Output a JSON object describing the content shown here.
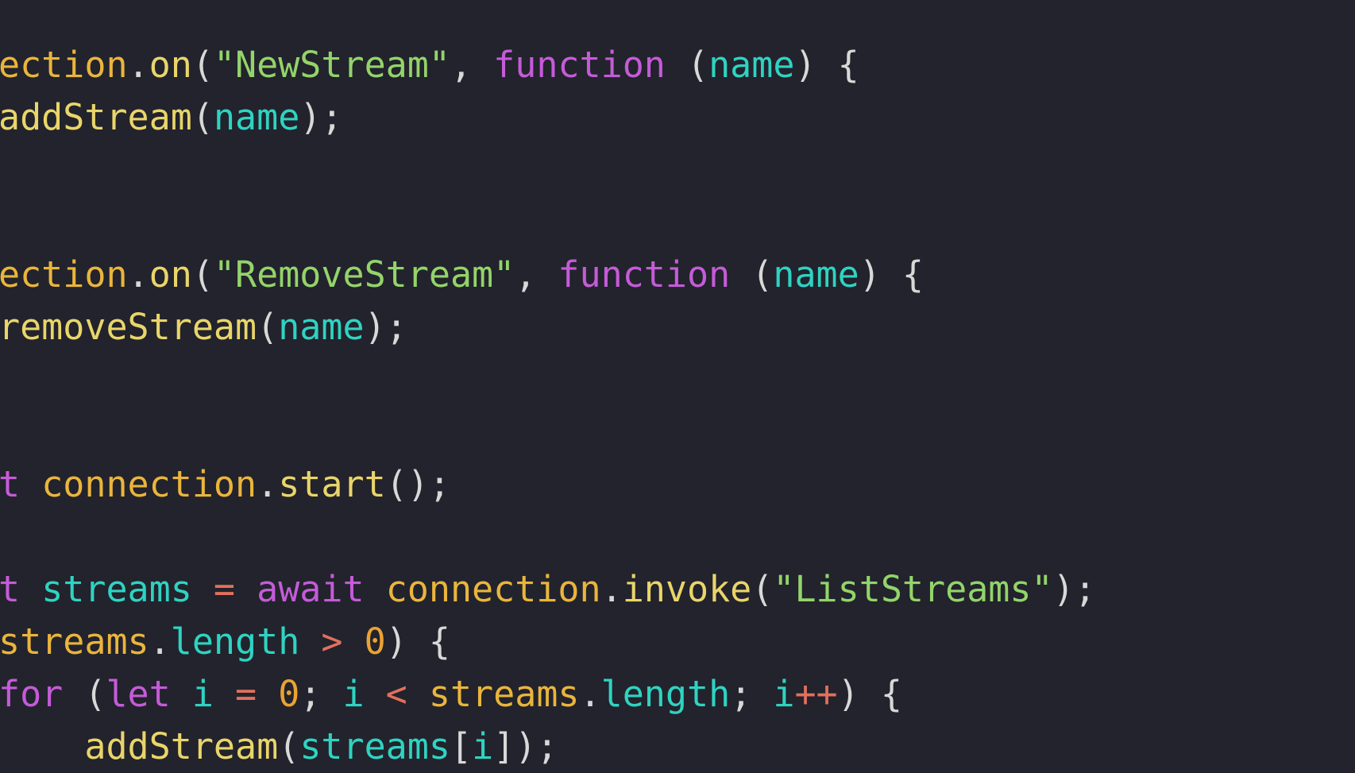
{
  "editor": {
    "theme_colors": {
      "background": "#22232c",
      "identifier": "#eab53c",
      "function": "#e9d56a",
      "string": "#93d46a",
      "keyword": "#c55bd8",
      "parameter": "#2fd3c2",
      "punctuation": "#d8d8d8",
      "operator": "#e2705c",
      "number": "#eaa332"
    },
    "lines": [
      [
        [
          "ident",
          "ection"
        ],
        [
          "punc",
          "."
        ],
        [
          "fn",
          "on"
        ],
        [
          "punc",
          "("
        ],
        [
          "str",
          "\"NewStream\""
        ],
        [
          "punc",
          ", "
        ],
        [
          "kw",
          "function"
        ],
        [
          "punc",
          " ("
        ],
        [
          "param",
          "name"
        ],
        [
          "punc",
          ") {"
        ]
      ],
      [
        [
          "fn",
          "addStream"
        ],
        [
          "punc",
          "("
        ],
        [
          "param",
          "name"
        ],
        [
          "punc",
          ");"
        ]
      ],
      [],
      [],
      [
        [
          "ident",
          "ection"
        ],
        [
          "punc",
          "."
        ],
        [
          "fn",
          "on"
        ],
        [
          "punc",
          "("
        ],
        [
          "str",
          "\"RemoveStream\""
        ],
        [
          "punc",
          ", "
        ],
        [
          "kw",
          "function"
        ],
        [
          "punc",
          " ("
        ],
        [
          "param",
          "name"
        ],
        [
          "punc",
          ") {"
        ]
      ],
      [
        [
          "fn",
          "removeStream"
        ],
        [
          "punc",
          "("
        ],
        [
          "param",
          "name"
        ],
        [
          "punc",
          ");"
        ]
      ],
      [],
      [],
      [
        [
          "kw",
          "t "
        ],
        [
          "ident",
          "connection"
        ],
        [
          "punc",
          "."
        ],
        [
          "fn",
          "start"
        ],
        [
          "punc",
          "();"
        ]
      ],
      [],
      [
        [
          "kw",
          "t "
        ],
        [
          "param",
          "streams"
        ],
        [
          "op",
          " = "
        ],
        [
          "kw",
          "await "
        ],
        [
          "ident",
          "connection"
        ],
        [
          "punc",
          "."
        ],
        [
          "fn",
          "invoke"
        ],
        [
          "punc",
          "("
        ],
        [
          "str",
          "\"ListStreams\""
        ],
        [
          "punc",
          ");"
        ]
      ],
      [
        [
          "ident",
          "streams"
        ],
        [
          "punc",
          "."
        ],
        [
          "param",
          "length"
        ],
        [
          "op",
          " > "
        ],
        [
          "num",
          "0"
        ],
        [
          "punc",
          ") {"
        ]
      ],
      [
        [
          "kw",
          "for"
        ],
        [
          "punc",
          " ("
        ],
        [
          "kw",
          "let "
        ],
        [
          "param",
          "i"
        ],
        [
          "op",
          " = "
        ],
        [
          "num",
          "0"
        ],
        [
          "punc",
          "; "
        ],
        [
          "param",
          "i"
        ],
        [
          "op",
          " < "
        ],
        [
          "ident",
          "streams"
        ],
        [
          "punc",
          "."
        ],
        [
          "param",
          "length"
        ],
        [
          "punc",
          "; "
        ],
        [
          "param",
          "i"
        ],
        [
          "op",
          "++"
        ],
        [
          "punc",
          ") {"
        ]
      ],
      [
        [
          "punc",
          "    "
        ],
        [
          "fn",
          "addStream"
        ],
        [
          "punc",
          "("
        ],
        [
          "param",
          "streams"
        ],
        [
          "punc",
          "["
        ],
        [
          "param",
          "i"
        ],
        [
          "punc",
          "]);"
        ]
      ]
    ]
  }
}
